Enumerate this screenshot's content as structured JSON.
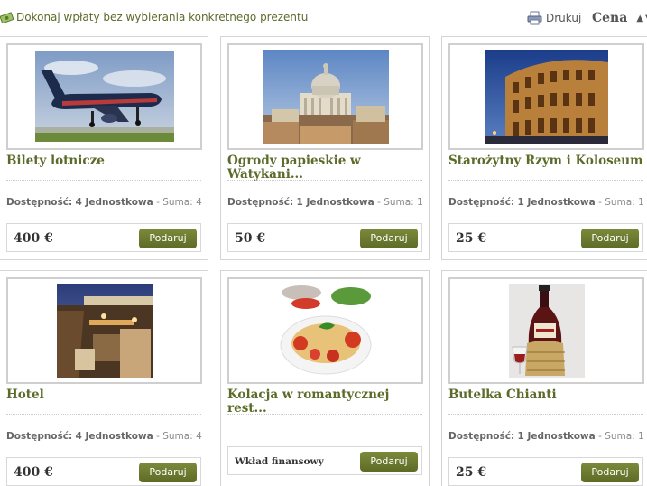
{
  "topbar": {
    "donate_link": "Dokonaj wpłaty bez wybierania konkretnego prezentu",
    "print_label": "Drukuj",
    "sort_label": "Cena"
  },
  "icons": {
    "donate": "money-icon",
    "print": "printer-icon",
    "sort": "sort-arrow-icon"
  },
  "colors": {
    "accent": "#5b6b2a",
    "button": "#6b7a30"
  },
  "gifts": [
    {
      "title": "Bilety lotnicze",
      "availability_label": "Dostępność:",
      "availability_value": "4 Jednostkowa",
      "sum_label": "- Suma:",
      "sum_value": "4",
      "price": "400 €",
      "button": "Podaruj",
      "image": "airplane"
    },
    {
      "title": "Ogrody papieskie w Watykani...",
      "availability_label": "Dostępność:",
      "availability_value": "1 Jednostkowa",
      "sum_label": "- Suma:",
      "sum_value": "1",
      "price": "50 €",
      "button": "Podaruj",
      "image": "vatican"
    },
    {
      "title": "Starożytny Rzym i Koloseum",
      "availability_label": "Dostępność:",
      "availability_value": "1 Jednostkowa",
      "sum_label": "- Suma:",
      "sum_value": "1",
      "price": "25 €",
      "button": "Podaruj",
      "image": "colosseum"
    },
    {
      "title": "Hotel",
      "availability_label": "Dostępność:",
      "availability_value": "4 Jednostkowa",
      "sum_label": "- Suma:",
      "sum_value": "4",
      "price": "400 €",
      "button": "Podaruj",
      "image": "hotel"
    },
    {
      "title": "Kolacja w romantycznej rest...",
      "contribution_label": "Wkład finansowy",
      "button": "Podaruj",
      "image": "pasta"
    },
    {
      "title": "Butelka Chianti",
      "availability_label": "Dostępność:",
      "availability_value": "1 Jednostkowa",
      "sum_label": "- Suma:",
      "sum_value": "1",
      "price": "25 €",
      "button": "Podaruj",
      "image": "wine"
    }
  ]
}
